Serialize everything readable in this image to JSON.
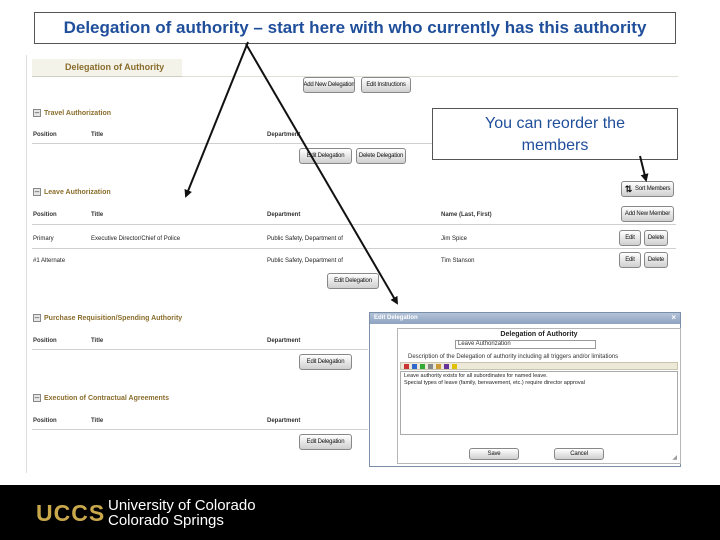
{
  "callouts": {
    "top": "Delegation of authority – start here with who currently has this authority",
    "reorder_line1": "You can reorder the",
    "reorder_line2": "members"
  },
  "page": {
    "title": "Delegation of Authority",
    "add_delegation_button": "Add New Delegation",
    "edit_instructions_button": "Edit Instructions"
  },
  "columns": {
    "position": "Position",
    "title": "Title",
    "department": "Department",
    "name": "Name (Last, First)"
  },
  "sections": [
    {
      "title": "Travel Authorization",
      "edit_button": "Edit Delegation",
      "delete_button": "Delete Delegation"
    },
    {
      "title": "Leave Authorization",
      "sort_button": "Sort Members",
      "add_member_button": "Add New Member",
      "rows": [
        {
          "position": "Primary",
          "title": "Executive Director/Chief of Police",
          "department": "Public Safety, Department of",
          "name": "Jim Spice",
          "edit": "Edit",
          "delete": "Delete"
        },
        {
          "position": "#1 Alternate",
          "title": "",
          "department": "Public Safety, Department of",
          "name": "Tim Stanson",
          "edit": "Edit",
          "delete": "Delete"
        }
      ],
      "edit_button": "Edit Delegation"
    },
    {
      "title": "Purchase Requisition/Spending Authority",
      "edit_button": "Edit Delegation"
    },
    {
      "title": "Execution of Contractual Agreements",
      "edit_button": "Edit Delegation"
    }
  ],
  "dialog": {
    "window_title": "Edit Delegation",
    "heading": "Delegation of Authority",
    "name_value": "Leave Authorization",
    "description_label": "Description of the Delegation of authority including all triggers and/or limitations",
    "body_line1": "Leave authority exists for all subordinates for named leave.",
    "body_line2": "Special types of leave (family, bereavement, etc.) require director approval",
    "save_button": "Save",
    "cancel_button": "Cancel"
  },
  "footer": {
    "logo_text": "UCCS",
    "line1": "University of Colorado",
    "line2": "Colorado Springs"
  },
  "colors": {
    "callout_text": "#1f4e9a",
    "section_title": "#8a6d2c",
    "logo_gold": "#c9a84c",
    "footer_bg": "#000000"
  }
}
